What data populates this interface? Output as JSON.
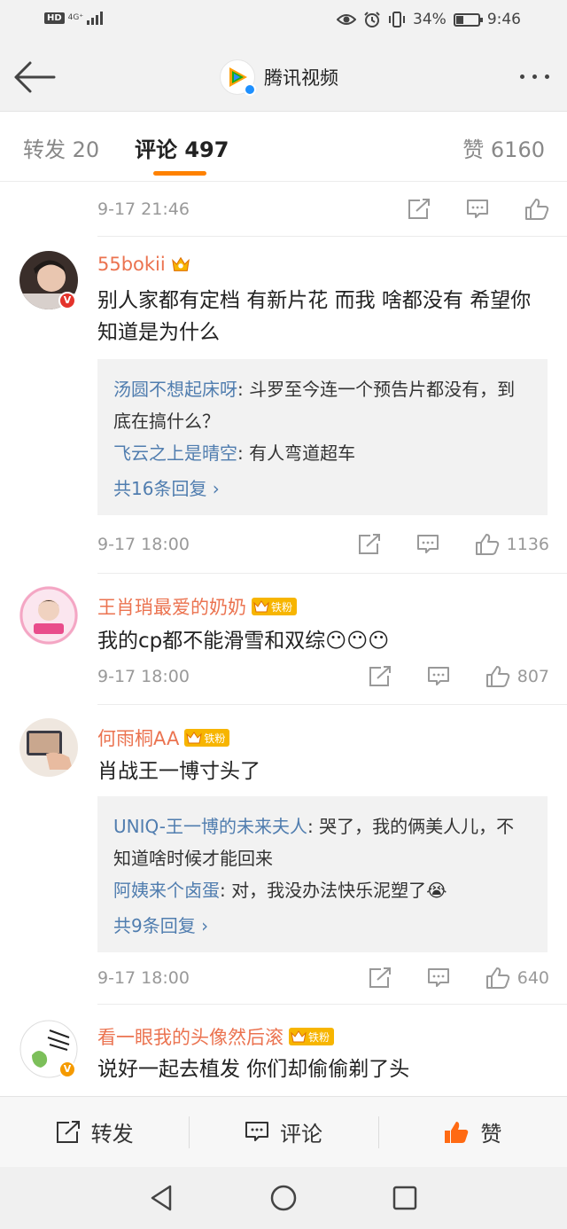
{
  "status_bar": {
    "network_badge": "HD",
    "network_type": "4G⁺",
    "battery_percent": "34%",
    "battery_level": 0.34,
    "time": "9:46"
  },
  "nav": {
    "title": "腾讯视频",
    "logo_color": "#1aad19"
  },
  "tabs": {
    "repost": "转发 20",
    "comment": "评论 497",
    "likes": "赞 6160"
  },
  "first_meta": {
    "time": "9-17 21:46"
  },
  "comments": [
    {
      "username": "55bokii",
      "text": "别人家都有定档 有新片花 而我 啥都没有 希望你知道是为什么",
      "replies": [
        {
          "name": "汤圆不想起床呀",
          "text": ": 斗罗至今连一个预告片都没有，到底在搞什么？"
        },
        {
          "name": "飞云之上是晴空",
          "text": ": 有人弯道超车"
        }
      ],
      "more_replies": "共16条回复 ›",
      "time": "9-17 18:00",
      "likes": "1136"
    },
    {
      "username": "王肖琑最爱的奶奶",
      "fan_tag": "铁粉",
      "text": "我的cp都不能滑雪和双综😶😶😶",
      "time": "9-17 18:00",
      "likes": "807"
    },
    {
      "username": "何雨桐AA",
      "fan_tag": "铁粉",
      "text": "肖战王一博寸头了",
      "replies": [
        {
          "name": "UNIQ-王一博的未来夫人",
          "text": ": 哭了，我的俩美人儿，不知道啥时候才能回来"
        },
        {
          "name": "阿姨来个卤蛋",
          "text": ": 对，我没办法快乐泥塑了😭"
        }
      ],
      "more_replies": "共9条回复 ›",
      "time": "9-17 18:00",
      "likes": "640"
    },
    {
      "username": "看一眼我的头像然后滚",
      "fan_tag": "铁粉",
      "text": "说好一起去植发 你们却偷偷剃了头"
    }
  ],
  "bottom_bar": {
    "repost": "转发",
    "comment": "评论",
    "like": "赞"
  },
  "colors": {
    "accent": "#ff8200",
    "username": "#eb7350",
    "link": "#507daf",
    "like_active": "#ff6a13"
  }
}
